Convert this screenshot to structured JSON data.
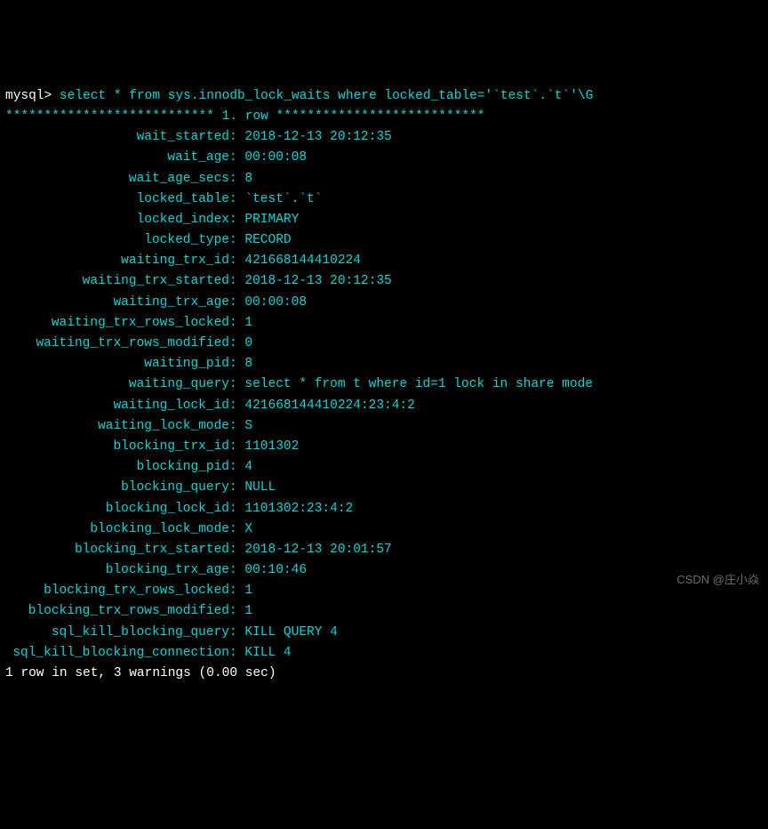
{
  "prompt": "mysql>",
  "query": " select * from sys.innodb_lock_waits where locked_table='`test`.`t`'\\G",
  "row_separator_left": "*************************** ",
  "row_separator_mid": "1. row",
  "row_separator_right": " ***************************",
  "fields": [
    {
      "name": "wait_started",
      "value": "2018-12-13 20:12:35"
    },
    {
      "name": "wait_age",
      "value": "00:00:08"
    },
    {
      "name": "wait_age_secs",
      "value": "8"
    },
    {
      "name": "locked_table",
      "value": "`test`.`t`"
    },
    {
      "name": "locked_index",
      "value": "PRIMARY"
    },
    {
      "name": "locked_type",
      "value": "RECORD"
    },
    {
      "name": "waiting_trx_id",
      "value": "421668144410224"
    },
    {
      "name": "waiting_trx_started",
      "value": "2018-12-13 20:12:35"
    },
    {
      "name": "waiting_trx_age",
      "value": "00:00:08"
    },
    {
      "name": "waiting_trx_rows_locked",
      "value": "1"
    },
    {
      "name": "waiting_trx_rows_modified",
      "value": "0"
    },
    {
      "name": "waiting_pid",
      "value": "8"
    },
    {
      "name": "waiting_query",
      "value": "select * from t where id=1 lock in share mode"
    },
    {
      "name": "waiting_lock_id",
      "value": "421668144410224:23:4:2"
    },
    {
      "name": "waiting_lock_mode",
      "value": "S"
    },
    {
      "name": "blocking_trx_id",
      "value": "1101302"
    },
    {
      "name": "blocking_pid",
      "value": "4"
    },
    {
      "name": "blocking_query",
      "value": "NULL"
    },
    {
      "name": "blocking_lock_id",
      "value": "1101302:23:4:2"
    },
    {
      "name": "blocking_lock_mode",
      "value": "X"
    },
    {
      "name": "blocking_trx_started",
      "value": "2018-12-13 20:01:57"
    },
    {
      "name": "blocking_trx_age",
      "value": "00:10:46"
    },
    {
      "name": "blocking_trx_rows_locked",
      "value": "1"
    },
    {
      "name": "blocking_trx_rows_modified",
      "value": "1"
    },
    {
      "name": "sql_kill_blocking_query",
      "value": "KILL QUERY 4"
    },
    {
      "name": "sql_kill_blocking_connection",
      "value": "KILL 4"
    }
  ],
  "footer": "1 row in set, 3 warnings (0.00 sec)",
  "watermark": "CSDN @庄小焱"
}
